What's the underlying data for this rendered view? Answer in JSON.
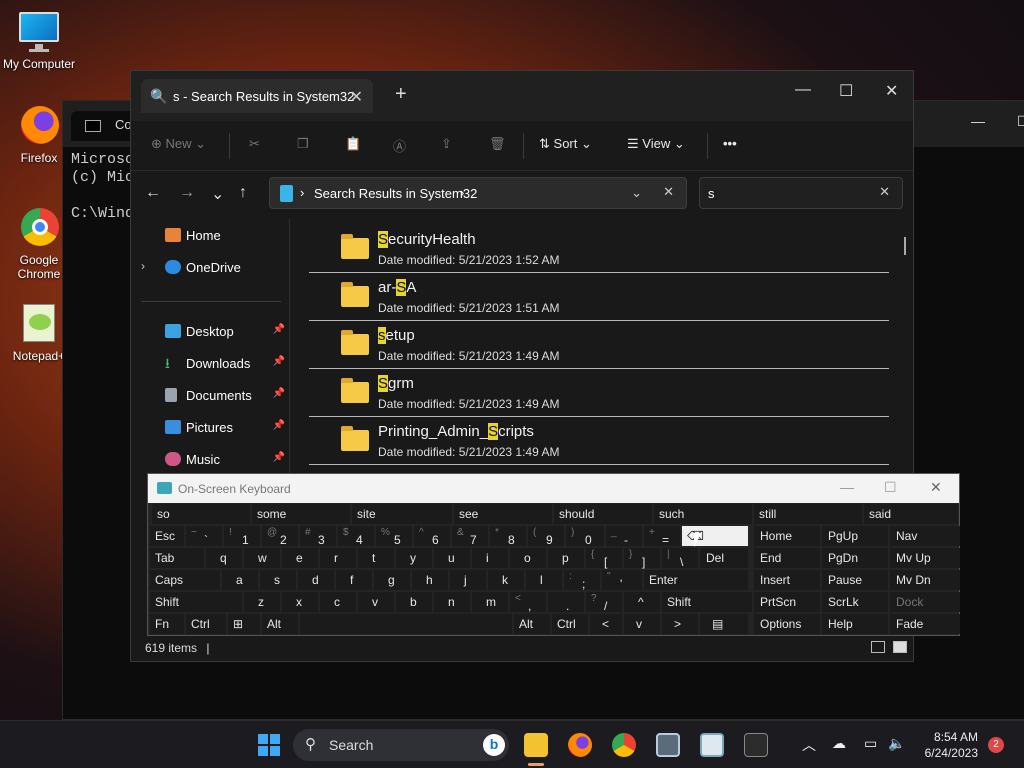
{
  "desktop": {
    "icons": [
      {
        "label": "My Computer",
        "icon": "monitor-icon"
      },
      {
        "label": "Firefox",
        "icon": "firefox-icon"
      },
      {
        "label": "Google Chrome",
        "icon": "chrome-icon"
      },
      {
        "label": "Notepad+",
        "icon": "notepadpp-icon"
      }
    ]
  },
  "cmd": {
    "tab_title": "Com",
    "lines": [
      "Microso",
      "(c) Mic",
      "",
      "C:\\Wind"
    ],
    "min": "—",
    "max": "☐"
  },
  "explorer": {
    "tab_title": "s - Search Results in System32",
    "tab_close": "✕",
    "new_tab": "+",
    "controls": {
      "min": "—",
      "max": "☐",
      "close": "✕"
    },
    "toolbar": {
      "new_label": "New",
      "sort_label": "Sort",
      "view_label": "View",
      "more_label": "•••"
    },
    "address": {
      "path": "Search Results in System32",
      "chevron": "›",
      "dropdown": "⌄",
      "clear": "✕"
    },
    "search": {
      "value": "s",
      "clear": "✕"
    },
    "nav": [
      {
        "label": "Home"
      },
      {
        "label": "OneDrive"
      },
      {
        "label": "Desktop"
      },
      {
        "label": "Downloads"
      },
      {
        "label": "Documents"
      },
      {
        "label": "Pictures"
      },
      {
        "label": "Music"
      }
    ],
    "files": [
      {
        "pre": "",
        "hl": "S",
        "post": "ecurityHealth",
        "meta": "Date modified:  5/21/2023 1:52 AM"
      },
      {
        "pre": "ar-",
        "hl": "S",
        "post": "A",
        "meta": "Date modified:  5/21/2023 1:51 AM"
      },
      {
        "pre": "",
        "hl": "s",
        "post": "etup",
        "meta": "Date modified:  5/21/2023 1:49 AM"
      },
      {
        "pre": "",
        "hl": "S",
        "post": "grm",
        "meta": "Date modified:  5/21/2023 1:49 AM"
      },
      {
        "pre": "Printing_Admin_",
        "hl": "S",
        "post": "cripts",
        "meta": "Date modified:  5/21/2023 1:49 AM"
      }
    ],
    "status": {
      "count": "619 items",
      "sep": "|"
    }
  },
  "osk": {
    "title": "On-Screen Keyboard",
    "controls": {
      "min": "—",
      "max": "☐",
      "close": "✕"
    },
    "predictions": [
      "so",
      "some",
      "site",
      "see",
      "should",
      "such",
      "still",
      "said"
    ],
    "row1": [
      {
        "label": "Esc"
      },
      {
        "top": "~",
        "bot": "`"
      },
      {
        "top": "!",
        "bot": "1"
      },
      {
        "top": "@",
        "bot": "2"
      },
      {
        "top": "#",
        "bot": "3"
      },
      {
        "top": "$",
        "bot": "4"
      },
      {
        "top": "%",
        "bot": "5"
      },
      {
        "top": "^",
        "bot": "6"
      },
      {
        "top": "&",
        "bot": "7"
      },
      {
        "top": "*",
        "bot": "8"
      },
      {
        "top": "(",
        "bot": "9"
      },
      {
        "top": ")",
        "bot": "0"
      },
      {
        "top": "_",
        "bot": "-"
      },
      {
        "top": "+",
        "bot": "="
      },
      {
        "label": "⌫"
      }
    ],
    "row2": [
      "Tab",
      "q",
      "w",
      "e",
      "r",
      "t",
      "y",
      "u",
      "i",
      "o",
      "p",
      "[",
      "]",
      "\\",
      "Del"
    ],
    "row2_tops": {
      "[": "{",
      "]": "}",
      "\\": "|"
    },
    "row3": [
      "Caps",
      "a",
      "s",
      "d",
      "f",
      "g",
      "h",
      "j",
      "k",
      "l",
      ";",
      "'",
      "Enter"
    ],
    "row3_tops": {
      ";": ":",
      "'": "\""
    },
    "row4": [
      "Shift",
      "z",
      "x",
      "c",
      "v",
      "b",
      "n",
      "m",
      ",",
      ".",
      "/",
      "^",
      "Shift"
    ],
    "row4_tops": {
      ",": "<",
      ".": ">",
      "/": "?"
    },
    "row5": [
      "Fn",
      "Ctrl",
      "⊞",
      "Alt",
      "",
      "Alt",
      "Ctrl",
      "<",
      "v",
      ">",
      "▤"
    ],
    "nav_keys": [
      [
        "Home",
        "PgUp",
        "Nav"
      ],
      [
        "End",
        "PgDn",
        "Mv Up"
      ],
      [
        "Insert",
        "Pause",
        "Mv Dn"
      ],
      [
        "PrtScn",
        "ScrLk",
        "Dock"
      ],
      [
        "Options",
        "Help",
        "Fade"
      ]
    ]
  },
  "taskbar": {
    "search_label": "Search",
    "bing": "b",
    "time": "8:54 AM",
    "date": "6/24/2023",
    "notification_count": "2"
  }
}
